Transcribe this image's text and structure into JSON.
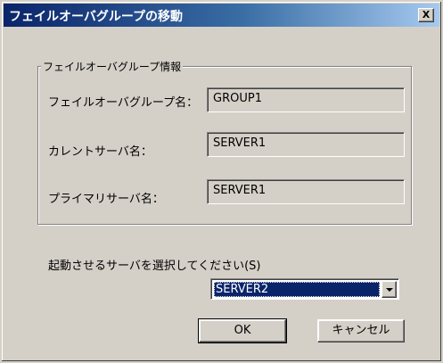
{
  "window": {
    "title": "フェイルオーバグループの移動",
    "close_label": "X"
  },
  "group_info": {
    "legend": "フェイルオーバグループ情報",
    "group_name_label": "フェイルオーバグループ名：",
    "group_name_value": "GROUP1",
    "current_server_label": "カレントサーバ名：",
    "current_server_value": "SERVER1",
    "primary_server_label": "プライマリサーバ名：",
    "primary_server_value": "SERVER1"
  },
  "selection": {
    "label": "起動させるサーバを選択してください(S)",
    "selected_value": "SERVER2"
  },
  "buttons": {
    "ok_label": "OK",
    "cancel_label": "キャンセル"
  }
}
